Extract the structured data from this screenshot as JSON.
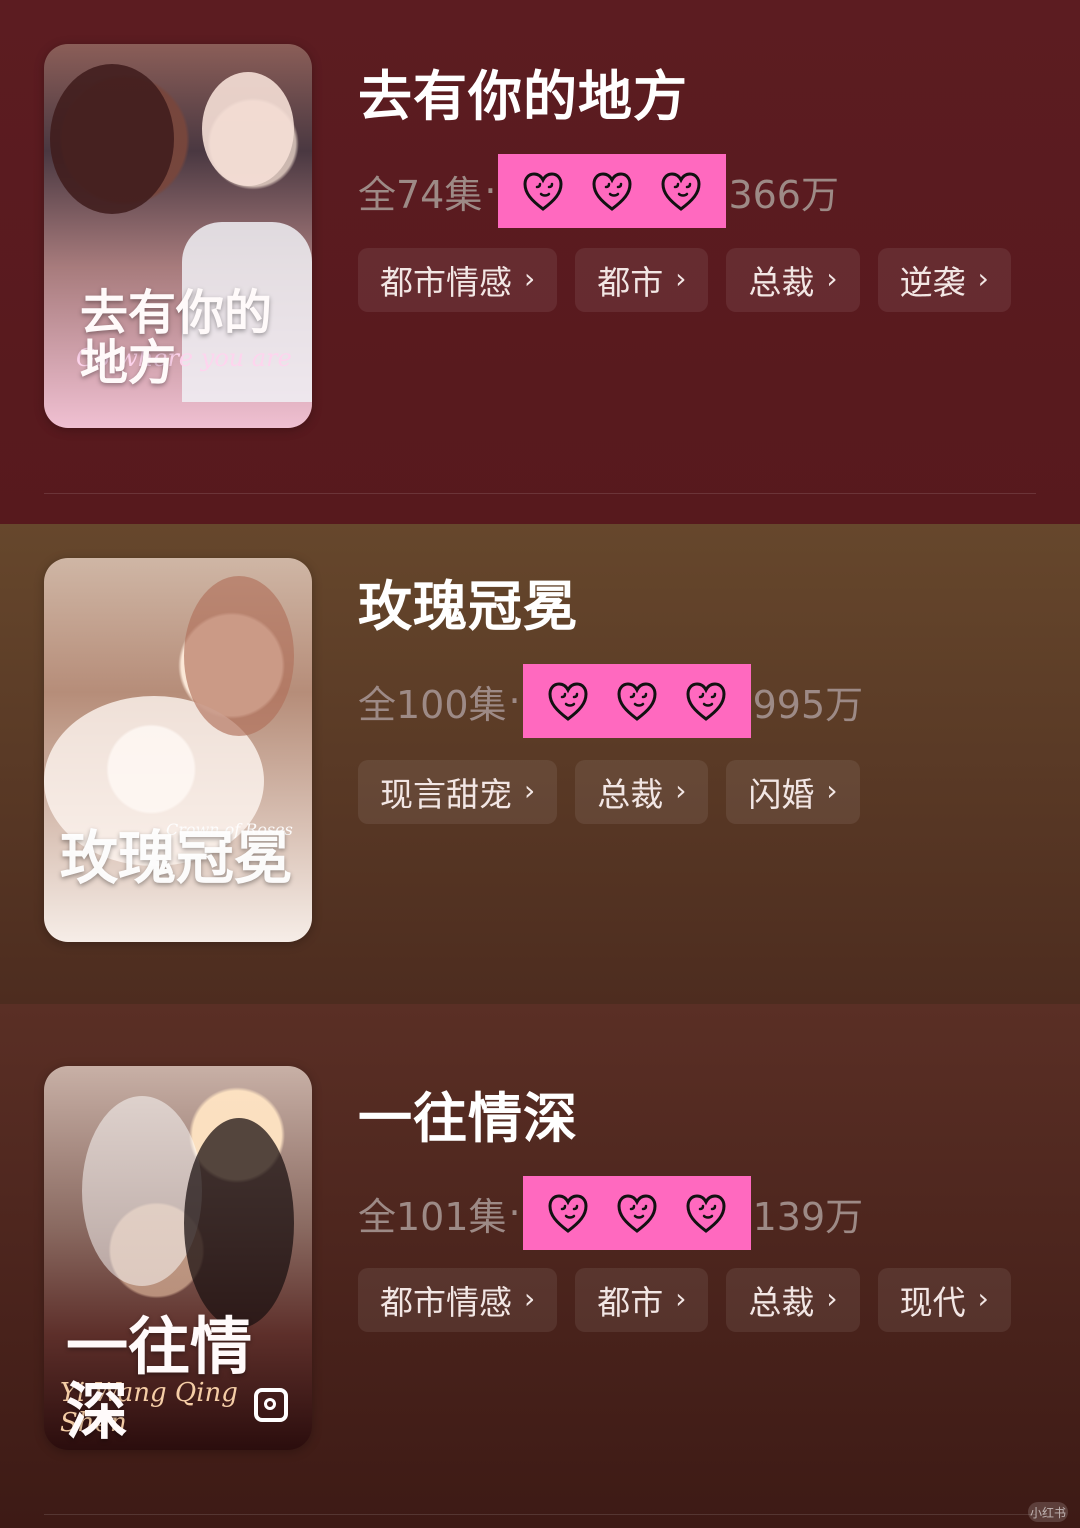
{
  "items": [
    {
      "title": "去有你的地方",
      "poster": {
        "title": "去有你的地方",
        "subtitle": "Go where you are"
      },
      "episodes_text": "全74集",
      "separator": "·",
      "views_text": "366万",
      "tags": [
        {
          "label": "都市情感",
          "icon": "chevron-right-icon"
        },
        {
          "label": "都市",
          "icon": "chevron-right-icon"
        },
        {
          "label": "总裁",
          "icon": "chevron-right-icon"
        },
        {
          "label": "逆袭",
          "icon": "chevron-right-icon"
        }
      ]
    },
    {
      "title": "玫瑰冠冕",
      "poster": {
        "title": "玫瑰冠冕",
        "subtitle": "Crown of Roses"
      },
      "episodes_text": "全100集",
      "separator": "·",
      "views_text": "995万",
      "tags": [
        {
          "label": "现言甜宠",
          "icon": "chevron-right-icon"
        },
        {
          "label": "总裁",
          "icon": "chevron-right-icon"
        },
        {
          "label": "闪婚",
          "icon": "chevron-right-icon"
        }
      ]
    },
    {
      "title": "一往情深",
      "poster": {
        "title": "一往情深",
        "subtitle": "Yi Wang Qing Shen"
      },
      "episodes_text": "全101集",
      "separator": "·",
      "views_text": "139万",
      "tags": [
        {
          "label": "都市情感",
          "icon": "chevron-right-icon"
        },
        {
          "label": "都市",
          "icon": "chevron-right-icon"
        },
        {
          "label": "总裁",
          "icon": "chevron-right-icon"
        },
        {
          "label": "现代",
          "icon": "chevron-right-icon"
        }
      ]
    }
  ],
  "icons": {
    "heart": "heart-icon",
    "chevron": "chevron-right-icon"
  },
  "colors": {
    "pink": "#ff69bf",
    "title": "#ffffff",
    "meta": "#9d8a86",
    "tag_bg": "rgba(255,255,255,0.08)",
    "tag_text": "#f2e6e4"
  },
  "watermark": "小红书"
}
